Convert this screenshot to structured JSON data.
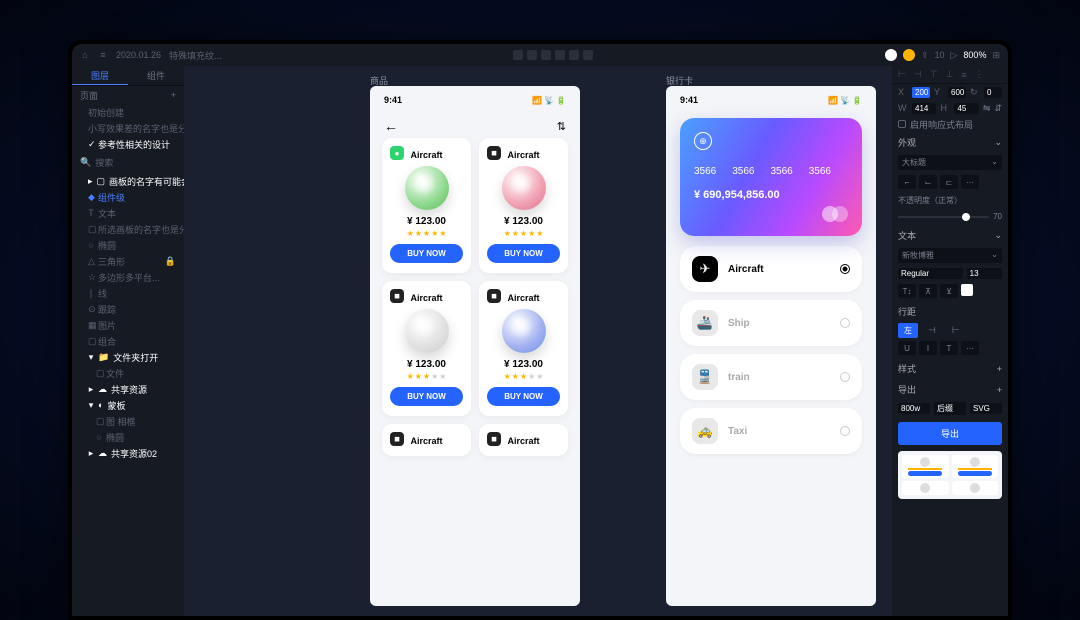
{
  "titlebar": {
    "date": "2020.01.26",
    "file": "特殊填充纹...",
    "zoom": "800%",
    "share": "10"
  },
  "sidebar": {
    "tabs": [
      "图层",
      "组件"
    ],
    "page_header": "页面",
    "pages": [
      "初始创建",
      "小写效果差的名字也是分有限...",
      "参考性相关的设计"
    ],
    "search": "搜索",
    "selected_layer": "画板的名字有可能会很长的...",
    "layers": [
      "组件级",
      "文本",
      "所选画板的名字也是分...",
      "椭圆",
      "三角形",
      "多边形多平台...",
      "线",
      "跟踪",
      "图片",
      "组合"
    ],
    "folder1": "文件夹打开",
    "folder1_child": "文件",
    "folder2": "共享资源",
    "folder3": "蒙板",
    "folder3_items": [
      "图 相框",
      "椭圆"
    ],
    "folder4": "共享资源02"
  },
  "canvas": {
    "label1": "商品",
    "label2": "银行卡"
  },
  "phone": {
    "time": "9:41"
  },
  "product": {
    "title": "Aircraft",
    "price": "¥ 123.00",
    "buy": "BUY NOW"
  },
  "card": {
    "num": "3566",
    "amount": "¥  690,954,856.00"
  },
  "transport": [
    {
      "label": "Aircraft",
      "icon": "✈",
      "active": true
    },
    {
      "label": "Ship",
      "icon": "🚢",
      "active": false
    },
    {
      "label": "train",
      "icon": "🚆",
      "active": false
    },
    {
      "label": "Taxi",
      "icon": "🚕",
      "active": false
    }
  ],
  "inspector": {
    "x": "200",
    "y": "600",
    "w": "414",
    "h": "45",
    "r": "0",
    "responsive": "启用响应式布局",
    "appearance": "外观",
    "fill_label": "大标题",
    "opacity_label": "不透明度（正常）",
    "opacity": "70",
    "text": "文本",
    "font": "新牧博雅",
    "weight": "Regular",
    "size": "13",
    "border": "行距",
    "style": "样式",
    "export": "导出",
    "export_w": "800w",
    "suffix": "后缀",
    "format": "SVG",
    "export_btn": "导出",
    "align": "左"
  }
}
